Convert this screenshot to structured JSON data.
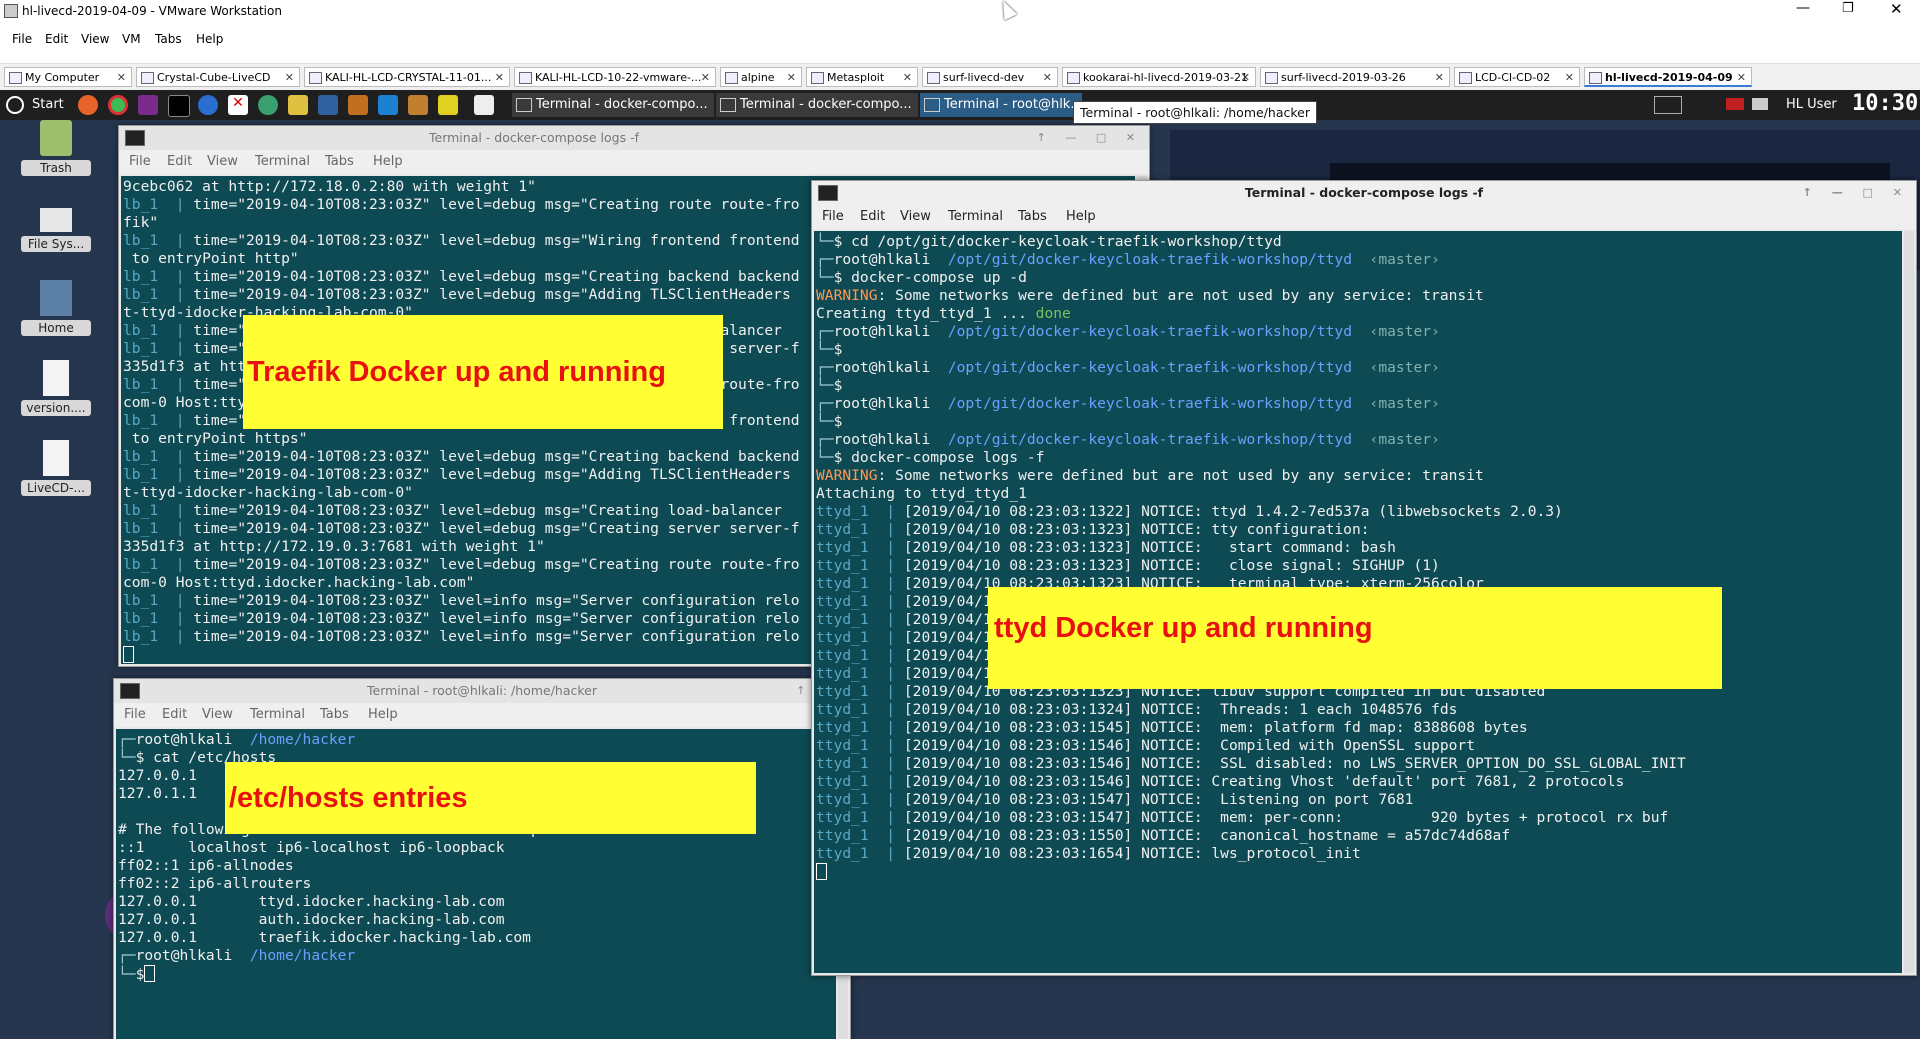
{
  "vmware": {
    "title": "hl-livecd-2019-04-09 - VMware Workstation",
    "menu": [
      "File",
      "Edit",
      "View",
      "VM",
      "Tabs",
      "Help"
    ],
    "tabs": [
      {
        "label": "My Computer",
        "active": false
      },
      {
        "label": "Crystal-Cube-LiveCD",
        "active": false
      },
      {
        "label": "KALI-HL-LCD-CRYSTAL-11-01...",
        "active": false
      },
      {
        "label": "KALI-HL-LCD-10-22-vmware-...",
        "active": false
      },
      {
        "label": "alpine",
        "active": false
      },
      {
        "label": "Metasploit",
        "active": false
      },
      {
        "label": "surf-livecd-dev",
        "active": false
      },
      {
        "label": "kookarai-hl-livecd-2019-03-21",
        "active": false
      },
      {
        "label": "surf-livecd-2019-03-26",
        "active": false
      },
      {
        "label": "LCD-CI-CD-02",
        "active": false
      },
      {
        "label": "hl-livecd-2019-04-09",
        "active": true
      }
    ]
  },
  "guest_taskbar": {
    "start_label": "Start",
    "tasks": [
      {
        "label": "Terminal - docker-compo...",
        "active": false
      },
      {
        "label": "Terminal - docker-compo...",
        "active": false
      },
      {
        "label": "Terminal - root@hlk...",
        "active": true
      }
    ],
    "user": "HL User",
    "clock": "10:30",
    "tooltip": "Terminal - root@hlkali: /home/hacker"
  },
  "desktop_icons": [
    "Trash",
    "File Sys...",
    "Home",
    "version....",
    "LiveCD-..."
  ],
  "terminal_menu": [
    "File",
    "Edit",
    "View",
    "Terminal",
    "Tabs",
    "Help"
  ],
  "term_traefik": {
    "title": "Terminal - docker-compose logs -f",
    "lines": [
      [
        [
          "",
          "9cebc062 at http://172.18.0.2:80 with weight 1\""
        ]
      ],
      [
        [
          "svc",
          "lb_1  | "
        ],
        [
          "",
          "time=\"2019-04-10T08:23:03Z\" level=debug msg=\"Creating route route-fro"
        ]
      ],
      [
        [
          "",
          "fik\""
        ]
      ],
      [
        [
          "svc",
          "lb_1  | "
        ],
        [
          "",
          "time=\"2019-04-10T08:23:03Z\" level=debug msg=\"Wiring frontend frontend"
        ]
      ],
      [
        [
          "",
          " to entryPoint http\""
        ]
      ],
      [
        [
          "svc",
          "lb_1  | "
        ],
        [
          "",
          "time=\"2019-04-10T08:23:03Z\" level=debug msg=\"Creating backend backend"
        ]
      ],
      [
        [
          "svc",
          "lb_1  | "
        ],
        [
          "",
          "time=\"2019-04-10T08:23:03Z\" level=debug msg=\"Adding TLSClientHeaders"
        ]
      ],
      [
        [
          "",
          "t-ttyd-idocker-hacking-lab-com-0\""
        ]
      ],
      [
        [
          "svc",
          "lb_1  | "
        ],
        [
          "",
          "time=\"2019-04-10T08:23:03Z\" level=debug msg=\"Creating load-balancer"
        ]
      ],
      [
        [
          "svc",
          "lb_1  | "
        ],
        [
          "",
          "time=\"2019-04-10T08:23:03Z\" level=debug msg=\"Creating server server-f"
        ]
      ],
      [
        [
          "",
          "335d1f3 at http://172.19.0.3:7681 with weight 1\""
        ]
      ],
      [
        [
          "svc",
          "lb_1  | "
        ],
        [
          "",
          "time=\"2019-04-10T08:23:03Z\" level=debug msg=\"Creating route route-fro"
        ]
      ],
      [
        [
          "",
          "com-0 Host:ttyd.idocker.hacking-lab.com\""
        ]
      ],
      [
        [
          "svc",
          "lb_1  | "
        ],
        [
          "",
          "time=\"2019-04-10T08:23:03Z\" level=debug msg=\"Wiring frontend frontend"
        ]
      ],
      [
        [
          "",
          " to entryPoint https\""
        ]
      ],
      [
        [
          "svc",
          "lb_1  | "
        ],
        [
          "",
          "time=\"2019-04-10T08:23:03Z\" level=debug msg=\"Creating backend backend"
        ]
      ],
      [
        [
          "svc",
          "lb_1  | "
        ],
        [
          "",
          "time=\"2019-04-10T08:23:03Z\" level=debug msg=\"Adding TLSClientHeaders"
        ]
      ],
      [
        [
          "",
          "t-ttyd-idocker-hacking-lab-com-0\""
        ]
      ],
      [
        [
          "svc",
          "lb_1  | "
        ],
        [
          "",
          "time=\"2019-04-10T08:23:03Z\" level=debug msg=\"Creating load-balancer"
        ]
      ],
      [
        [
          "svc",
          "lb_1  | "
        ],
        [
          "",
          "time=\"2019-04-10T08:23:03Z\" level=debug msg=\"Creating server server-f"
        ]
      ],
      [
        [
          "",
          "335d1f3 at http://172.19.0.3:7681 with weight 1\""
        ]
      ],
      [
        [
          "svc",
          "lb_1  | "
        ],
        [
          "",
          "time=\"2019-04-10T08:23:03Z\" level=debug msg=\"Creating route route-fro"
        ]
      ],
      [
        [
          "",
          "com-0 Host:ttyd.idocker.hacking-lab.com\""
        ]
      ],
      [
        [
          "svc",
          "lb_1  | "
        ],
        [
          "",
          "time=\"2019-04-10T08:23:03Z\" level=info msg=\"Server configuration relo"
        ]
      ],
      [
        [
          "svc",
          "lb_1  | "
        ],
        [
          "",
          "time=\"2019-04-10T08:23:03Z\" level=info msg=\"Server configuration relo"
        ]
      ],
      [
        [
          "svc",
          "lb_1  | "
        ],
        [
          "",
          "time=\"2019-04-10T08:23:03Z\" level=info msg=\"Server configuration relo"
        ]
      ],
      [
        [
          "cursor",
          ""
        ]
      ]
    ]
  },
  "term_ttyd": {
    "title": "Terminal - docker-compose logs -f",
    "lines": [
      [
        [
          "prm",
          "└─"
        ],
        [
          "",
          "$ cd /opt/git/docker-keycloak-traefik-workshop/ttyd"
        ]
      ],
      [
        [
          "prm",
          "┌─"
        ],
        [
          "",
          "root@hlkali  "
        ],
        [
          "path",
          "/opt/git/docker-keycloak-traefik-workshop/ttyd"
        ],
        [
          "branch",
          "  ‹master›"
        ]
      ],
      [
        [
          "prm",
          "└─"
        ],
        [
          "",
          "$ docker-compose up -d"
        ]
      ],
      [
        [
          "warn",
          "WARNING"
        ],
        [
          "",
          ": Some networks were defined but are not used by any service: transit"
        ]
      ],
      [
        [
          "",
          "Creating ttyd_ttyd_1 ... "
        ],
        [
          "done",
          "done"
        ]
      ],
      [
        [
          "prm",
          "┌─"
        ],
        [
          "",
          "root@hlkali  "
        ],
        [
          "path",
          "/opt/git/docker-keycloak-traefik-workshop/ttyd"
        ],
        [
          "branch",
          "  ‹master›"
        ]
      ],
      [
        [
          "prm",
          "└─"
        ],
        [
          "",
          "$"
        ]
      ],
      [
        [
          "prm",
          "┌─"
        ],
        [
          "",
          "root@hlkali  "
        ],
        [
          "path",
          "/opt/git/docker-keycloak-traefik-workshop/ttyd"
        ],
        [
          "branch",
          "  ‹master›"
        ]
      ],
      [
        [
          "prm",
          "└─"
        ],
        [
          "",
          "$"
        ]
      ],
      [
        [
          "prm",
          "┌─"
        ],
        [
          "",
          "root@hlkali  "
        ],
        [
          "path",
          "/opt/git/docker-keycloak-traefik-workshop/ttyd"
        ],
        [
          "branch",
          "  ‹master›"
        ]
      ],
      [
        [
          "prm",
          "└─"
        ],
        [
          "",
          "$"
        ]
      ],
      [
        [
          "prm",
          "┌─"
        ],
        [
          "",
          "root@hlkali  "
        ],
        [
          "path",
          "/opt/git/docker-keycloak-traefik-workshop/ttyd"
        ],
        [
          "branch",
          "  ‹master›"
        ]
      ],
      [
        [
          "prm",
          "└─"
        ],
        [
          "",
          "$ docker-compose logs -f"
        ]
      ],
      [
        [
          "warn",
          "WARNING"
        ],
        [
          "",
          ": Some networks were defined but are not used by any service: transit"
        ]
      ],
      [
        [
          "",
          "Attaching to ttyd_ttyd_1"
        ]
      ],
      [
        [
          "svc",
          "ttyd_1  | "
        ],
        [
          "",
          "[2019/04/10 08:23:03:1322] NOTICE: ttyd 1.4.2-7ed537a (libwebsockets 2.0.3)"
        ]
      ],
      [
        [
          "svc",
          "ttyd_1  | "
        ],
        [
          "",
          "[2019/04/10 08:23:03:1323] NOTICE: tty configuration:"
        ]
      ],
      [
        [
          "svc",
          "ttyd_1  | "
        ],
        [
          "",
          "[2019/04/10 08:23:03:1323] NOTICE:   start command: bash"
        ]
      ],
      [
        [
          "svc",
          "ttyd_1  | "
        ],
        [
          "",
          "[2019/04/10 08:23:03:1323] NOTICE:   close signal: SIGHUP (1)"
        ]
      ],
      [
        [
          "svc",
          "ttyd_1  | "
        ],
        [
          "",
          "[2019/04/10 08:23:03:1323] NOTICE:   terminal type: xterm-256color"
        ]
      ],
      [
        [
          "svc",
          "ttyd_1  | "
        ],
        [
          "",
          "[2019/04/1"
        ]
      ],
      [
        [
          "svc",
          "ttyd_1  | "
        ],
        [
          "",
          "[2019/04/1"
        ]
      ],
      [
        [
          "svc",
          "ttyd_1  | "
        ],
        [
          "",
          "[2019/04/1"
        ]
      ],
      [
        [
          "svc",
          "ttyd_1  | "
        ],
        [
          "",
          "[2019/04/1"
        ]
      ],
      [
        [
          "svc",
          "ttyd_1  | "
        ],
        [
          "",
          "[2019/04/1"
        ]
      ],
      [
        [
          "svc",
          "ttyd_1  | "
        ],
        [
          "",
          "[2019/04/10 08:23:03:1323] NOTICE: libuv support compiled in but disabled"
        ]
      ],
      [
        [
          "svc",
          "ttyd_1  | "
        ],
        [
          "",
          "[2019/04/10 08:23:03:1324] NOTICE:  Threads: 1 each 1048576 fds"
        ]
      ],
      [
        [
          "svc",
          "ttyd_1  | "
        ],
        [
          "",
          "[2019/04/10 08:23:03:1545] NOTICE:  mem: platform fd map: 8388608 bytes"
        ]
      ],
      [
        [
          "svc",
          "ttyd_1  | "
        ],
        [
          "",
          "[2019/04/10 08:23:03:1546] NOTICE:  Compiled with OpenSSL support"
        ]
      ],
      [
        [
          "svc",
          "ttyd_1  | "
        ],
        [
          "",
          "[2019/04/10 08:23:03:1546] NOTICE:  SSL disabled: no LWS_SERVER_OPTION_DO_SSL_GLOBAL_INIT"
        ]
      ],
      [
        [
          "svc",
          "ttyd_1  | "
        ],
        [
          "",
          "[2019/04/10 08:23:03:1546] NOTICE: Creating Vhost 'default' port 7681, 2 protocols"
        ]
      ],
      [
        [
          "svc",
          "ttyd_1  | "
        ],
        [
          "",
          "[2019/04/10 08:23:03:1547] NOTICE:  Listening on port 7681"
        ]
      ],
      [
        [
          "svc",
          "ttyd_1  | "
        ],
        [
          "",
          "[2019/04/10 08:23:03:1547] NOTICE:  mem: per-conn:          920 bytes + protocol rx buf"
        ]
      ],
      [
        [
          "svc",
          "ttyd_1  | "
        ],
        [
          "",
          "[2019/04/10 08:23:03:1550] NOTICE:  canonical_hostname = a57dc74d68af"
        ]
      ],
      [
        [
          "svc",
          "ttyd_1  | "
        ],
        [
          "",
          "[2019/04/10 08:23:03:1654] NOTICE: lws_protocol_init"
        ]
      ],
      [
        [
          "cursor",
          ""
        ]
      ]
    ]
  },
  "term_hosts": {
    "title": "Terminal - root@hlkali: /home/hacker",
    "lines": [
      [
        [
          "prm",
          "┌─"
        ],
        [
          "",
          "root@hlkali  "
        ],
        [
          "path",
          "/home/hacker"
        ]
      ],
      [
        [
          "prm",
          "└─"
        ],
        [
          "",
          "$ cat /etc/hosts"
        ]
      ],
      [
        [
          "",
          "127.0.0.1"
        ]
      ],
      [
        [
          "",
          "127.0.1.1"
        ]
      ],
      [
        [
          "",
          ""
        ]
      ],
      [
        [
          "",
          "# The following lines are desirable for IPv6 capable hosts"
        ]
      ],
      [
        [
          "",
          "::1     localhost ip6-localhost ip6-loopback"
        ]
      ],
      [
        [
          "",
          "ff02::1 ip6-allnodes"
        ]
      ],
      [
        [
          "",
          "ff02::2 ip6-allrouters"
        ]
      ],
      [
        [
          "",
          "127.0.0.1       ttyd.idocker.hacking-lab.com"
        ]
      ],
      [
        [
          "",
          "127.0.0.1       auth.idocker.hacking-lab.com"
        ]
      ],
      [
        [
          "",
          "127.0.0.1       traefik.idocker.hacking-lab.com"
        ]
      ],
      [
        [
          "prm",
          "┌─"
        ],
        [
          "",
          "root@hlkali  "
        ],
        [
          "path",
          "/home/hacker"
        ]
      ],
      [
        [
          "prm",
          "└─"
        ],
        [
          "",
          "$"
        ],
        [
          "cursor",
          ""
        ]
      ]
    ]
  },
  "callouts": {
    "traefik": "Traefik Docker up and running",
    "ttyd": "ttyd Docker up and running",
    "hosts": "/etc/hosts entries"
  }
}
